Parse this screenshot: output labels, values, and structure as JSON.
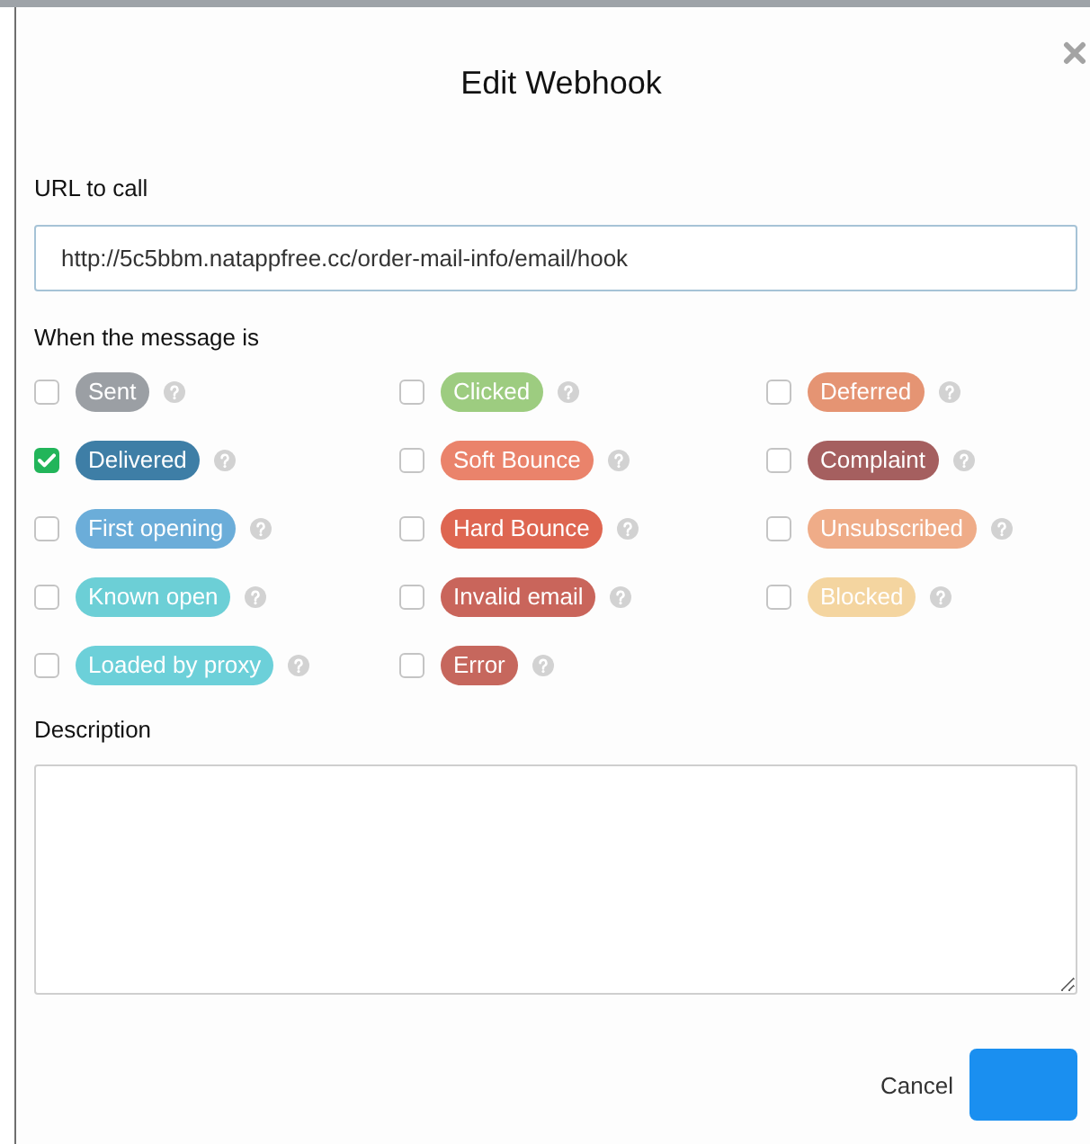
{
  "dialog": {
    "title": "Edit Webhook"
  },
  "url_field": {
    "label": "URL to call",
    "value": "http://5c5bbm.natappfree.cc/order-mail-info/email/hook"
  },
  "events": {
    "label": "When the message is",
    "items": [
      {
        "label": "Sent",
        "checked": false,
        "color": "#9b9fa4"
      },
      {
        "label": "Clicked",
        "checked": false,
        "color": "#9dcc80"
      },
      {
        "label": "Deferred",
        "checked": false,
        "color": "#e59473"
      },
      {
        "label": "Delivered",
        "checked": true,
        "color": "#3e7ea6"
      },
      {
        "label": "Soft Bounce",
        "checked": false,
        "color": "#ea836b"
      },
      {
        "label": "Complaint",
        "checked": false,
        "color": "#a55f5f"
      },
      {
        "label": "First opening",
        "checked": false,
        "color": "#6badd9"
      },
      {
        "label": "Hard Bounce",
        "checked": false,
        "color": "#de6651"
      },
      {
        "label": "Unsubscribed",
        "checked": false,
        "color": "#efac88"
      },
      {
        "label": "Known open",
        "checked": false,
        "color": "#6ccfd6"
      },
      {
        "label": "Invalid email",
        "checked": false,
        "color": "#c9655b"
      },
      {
        "label": "Blocked",
        "checked": false,
        "color": "#f4d5a0"
      },
      {
        "label": "Loaded by proxy",
        "checked": false,
        "color": "#6cd0d9"
      },
      {
        "label": "Error",
        "checked": false,
        "color": "#c6675d"
      }
    ]
  },
  "description": {
    "label": "Description"
  },
  "buttons": [
    {
      "kind": "link",
      "label": "Cancel"
    },
    {
      "kind": "primary"
    }
  ]
}
